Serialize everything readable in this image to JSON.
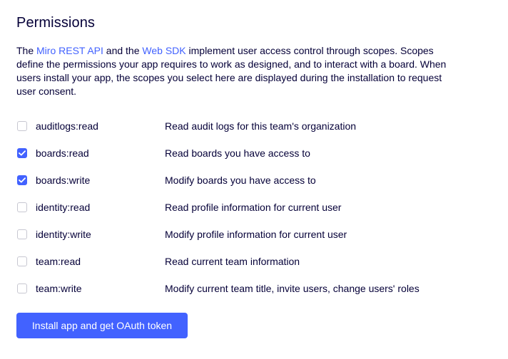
{
  "page": {
    "title": "Permissions",
    "description": {
      "part1": "The ",
      "link1": "Miro REST API",
      "part2": " and the ",
      "link2": "Web SDK",
      "part3": " implement user access control through scopes. Scopes define the permissions your app requires to work as designed, and to interact with a board. When users install your app, the scopes you select here are displayed during the installation to request user consent."
    }
  },
  "scopes": [
    {
      "name": "auditlogs:read",
      "description": "Read audit logs for this team's organization",
      "checked": false
    },
    {
      "name": "boards:read",
      "description": "Read boards you have access to",
      "checked": true
    },
    {
      "name": "boards:write",
      "description": "Modify boards you have access to",
      "checked": true
    },
    {
      "name": "identity:read",
      "description": "Read profile information for current user",
      "checked": false
    },
    {
      "name": "identity:write",
      "description": "Modify profile information for current user",
      "checked": false
    },
    {
      "name": "team:read",
      "description": "Read current team information",
      "checked": false
    },
    {
      "name": "team:write",
      "description": "Modify current team title, invite users, change users' roles",
      "checked": false
    }
  ],
  "install_button": {
    "label": "Install app and get OAuth token"
  },
  "colors": {
    "accent": "#4262ff",
    "text": "#050038",
    "checkbox_border": "#c7c7d1"
  }
}
